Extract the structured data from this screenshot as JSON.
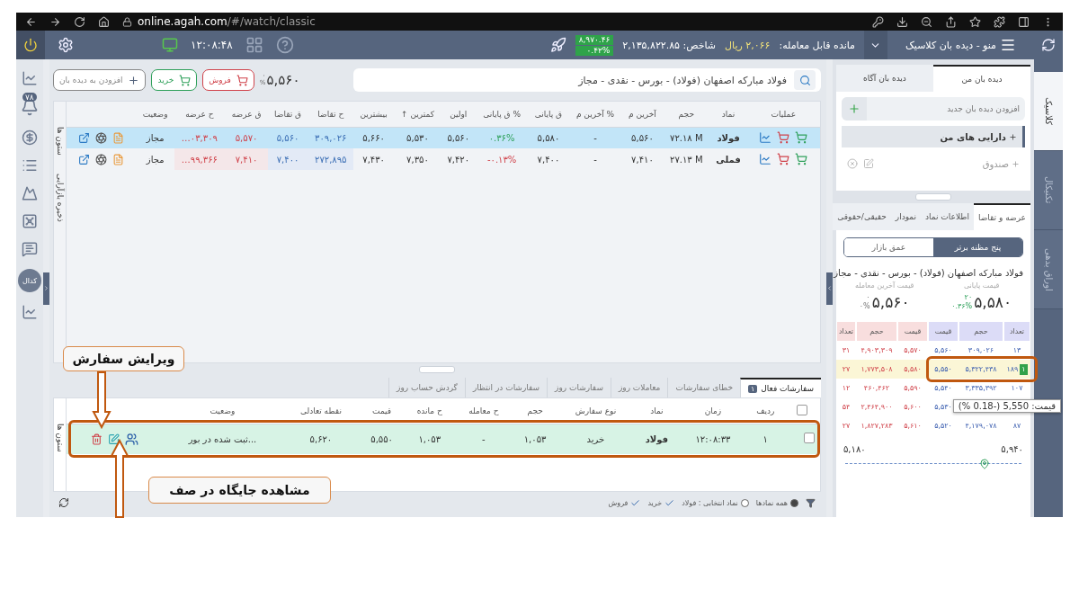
{
  "browser": {
    "url_host": "online.agah.com",
    "url_path": "/#/watch/classic"
  },
  "topbar": {
    "clock": "۱۲:۰۸:۴۸",
    "menu": "منو - دیده بان کلاسیک",
    "balance_label": "مانده قابل معامله:",
    "balance_value": "۲,۰۶۶ ریال",
    "index": "شاخص: ۲,۱۳۵,۸۲۲.۸۵",
    "index_change": "۸,۹۷۰.۴۶",
    "index_percent": "۰.۴۲%"
  },
  "sidebar": {
    "bell_badge": "۷۸",
    "codal": "کدال"
  },
  "toolbar": {
    "search_value": "فولاد مبارکه اصفهان (فولاد) - بورس - نقدی - مجاز",
    "price": "۵,۵۶۰",
    "price_change": "۰",
    "price_percent": "%",
    "sell": "فروش",
    "buy": "خرید",
    "add_watch": "افزودن به دیده بان"
  },
  "watchlist": {
    "side_labels": [
      "ستون ها",
      "ذخیره بازآرایی"
    ],
    "columns": [
      {
        "label": "عملیات",
        "kind": "ops"
      },
      {
        "label": "نماد",
        "kind": "symbol"
      },
      {
        "label": "حجم",
        "kind": "plain"
      },
      {
        "label": "آخرین م",
        "kind": "plain"
      },
      {
        "label": "% آخرین م",
        "kind": "plain"
      },
      {
        "label": "ق پایانی",
        "kind": "plain"
      },
      {
        "label": "% ق پایانی",
        "kind": "pct"
      },
      {
        "label": "اولین",
        "kind": "plain"
      },
      {
        "label": "کمترین ↑",
        "kind": "plain"
      },
      {
        "label": "بیشترین",
        "kind": "plain"
      },
      {
        "label": "ح تقاضا",
        "kind": "bid"
      },
      {
        "label": "ق تقاضا",
        "kind": "bid"
      },
      {
        "label": "ق عرضه",
        "kind": "ask"
      },
      {
        "label": "ح عرضه",
        "kind": "ask"
      },
      {
        "label": "وضعیت",
        "kind": "status"
      }
    ],
    "rows": [
      {
        "selected": true,
        "color": "#2ea05a",
        "cells": [
          "",
          "فولاد",
          "۷۲.۱۸ M",
          "۵,۵۶۰",
          "-",
          "۵,۵۸۰",
          "۰.۳۶%",
          "۵,۵۶۰",
          "۵,۵۳۰",
          "۵,۶۶۰",
          "۳۰۹,۰۲۶",
          "۵,۵۶۰",
          "۵,۵۷۰",
          "…۰۳,۳۰۹",
          "مجاز"
        ]
      },
      {
        "selected": false,
        "color": "#d0424a",
        "cells": [
          "",
          "فملی",
          "۲۷.۱۳ M",
          "۷,۴۱۰",
          "-",
          "۷,۴۰۰",
          "-۰.۱۳%",
          "۷,۴۲۰",
          "۷,۳۵۰",
          "۷,۴۳۰",
          "۲۷۲,۸۹۵",
          "۷,۴۰۰",
          "۷,۴۱۰",
          "…۹۹,۳۶۶",
          "مجاز"
        ]
      }
    ]
  },
  "orders": {
    "tabs": [
      {
        "label": "سفارشات فعال",
        "badge": "۱",
        "selected": true
      },
      {
        "label": "خطای سفارشات",
        "selected": false
      },
      {
        "label": "معاملات روز",
        "selected": false
      },
      {
        "label": "سفارشات روز",
        "selected": false
      },
      {
        "label": "سفارشات در انتظار",
        "selected": false
      },
      {
        "label": "گردش حساب روز",
        "selected": false
      }
    ],
    "side_label": "ستون ها",
    "select_all_checked": false,
    "columns": [
      {
        "label": "ردیف",
        "kind": "plain"
      },
      {
        "label": "زمان",
        "kind": "plain"
      },
      {
        "label": "نماد",
        "kind": "symbol"
      },
      {
        "label": "نوع سفارش",
        "kind": "plain"
      },
      {
        "label": "حجم",
        "kind": "plain"
      },
      {
        "label": "ح معامله",
        "kind": "plain"
      },
      {
        "label": "ح مانده",
        "kind": "plain"
      },
      {
        "label": "قیمت",
        "kind": "plain"
      },
      {
        "label": "نقطه تعادلی",
        "kind": "plain"
      },
      {
        "label": "وضعیت",
        "kind": "status"
      }
    ],
    "rows": [
      {
        "checked": false,
        "cells": [
          "۱",
          "۱۲:۰۸:۳۳",
          "فولاد",
          "خرید",
          "۱,۰۵۳",
          "-",
          "۱,۰۵۳",
          "۵,۵۵۰",
          "۵,۶۲۰",
          "ثبت شده در بور..."
        ]
      }
    ],
    "filter": {
      "all": {
        "label": "همه نمادها",
        "selected": true
      },
      "symbol": {
        "label": "نماد انتخابی : فولاد",
        "selected": false
      },
      "buy": {
        "label": "خرید",
        "checked": true
      },
      "sell": {
        "label": "فروش",
        "checked": true
      }
    }
  },
  "watch_panel": {
    "tabs": [
      {
        "label": "دیده بان من",
        "selected": true
      },
      {
        "label": "دیده بان آگاه",
        "selected": false
      }
    ],
    "add_placeholder": "افزودن دیده بان جدید",
    "items": [
      {
        "label": "دارایی های من",
        "selected": true
      },
      {
        "label": "صندوق",
        "selected": false
      }
    ]
  },
  "detail": {
    "tabs": [
      {
        "label": "عرضه و تقاضا",
        "selected": true
      },
      {
        "label": "اطلاعات نماد",
        "selected": false
      },
      {
        "label": "نمودار",
        "selected": false
      },
      {
        "label": "حقیقی/حقوقی",
        "selected": false
      }
    ],
    "toggle": [
      {
        "label": "پنج مظنه برتر",
        "selected": true
      },
      {
        "label": "عمق بازار",
        "selected": false
      }
    ],
    "title": "فولاد مبارکه اصفهان (فولاد) - بورس - نقدی - مجاز",
    "close_label": "قیمت پایانی",
    "close_value": "۵,۵۸۰",
    "close_change": "۲۰",
    "close_pct": "۰.۳۶%",
    "last_label": "قیمت آخرین معامله",
    "last_value": "۵,۵۶۰",
    "last_change": "۰",
    "last_pct": "۰%",
    "buy_headers": [
      "تعداد",
      "حجم",
      "قیمت"
    ],
    "sell_headers": [
      "قیمت",
      "حجم",
      "تعداد"
    ],
    "book_rows": [
      {
        "own": false,
        "buy": [
          "۱۳",
          "۳۰۹,۰۲۶",
          "۵,۵۶۰"
        ],
        "sell": [
          "۵,۵۷۰",
          "۴,۹۰۳,۳۰۹",
          "۳۱"
        ]
      },
      {
        "own": true,
        "badge": "۱",
        "buy": [
          "۱۸۹",
          "۵,۳۲۲,۴۳۸",
          "۵,۵۵۰"
        ],
        "sell": [
          "۵,۵۸۰",
          "۱,۷۷۳,۵۰۸",
          "۲۷"
        ]
      },
      {
        "own": false,
        "buy": [
          "۱۰۷",
          "۳,۳۳۵,۳۹۲",
          "۵,۵۴۰"
        ],
        "sell": [
          "۵,۵۹۰",
          "۴۶۰,۴۶۲",
          "۱۲"
        ]
      },
      {
        "own": false,
        "tooltip": "قیمت: 5,550 (-0.18 %)",
        "buy": [
          "۵,۵۳۰"
        ],
        "sell": [
          "۵,۶۰۰",
          "۲,۴۶۴,۹۰۰",
          "۵۴"
        ]
      },
      {
        "own": false,
        "buy": [
          "۸۷",
          "۴,۱۷۹,۰۷۸",
          "۵,۵۲۰"
        ],
        "sell": [
          "۵,۶۱۰",
          "۱,۸۲۷,۲۸۳",
          "۲۷"
        ]
      }
    ],
    "range_min": "۵,۱۸۰",
    "range_max": "۵,۹۴۰",
    "level": 0.79
  },
  "side_tabs": [
    {
      "label": "کلاسیک",
      "selected": true
    },
    {
      "label": "تکنیکال",
      "selected": false
    },
    {
      "label": "اوراق بدهی",
      "selected": false
    }
  ],
  "annotations": [
    {
      "text": "ویرایش سفارش"
    },
    {
      "text": "مشاهده جایگاه در صف"
    }
  ]
}
